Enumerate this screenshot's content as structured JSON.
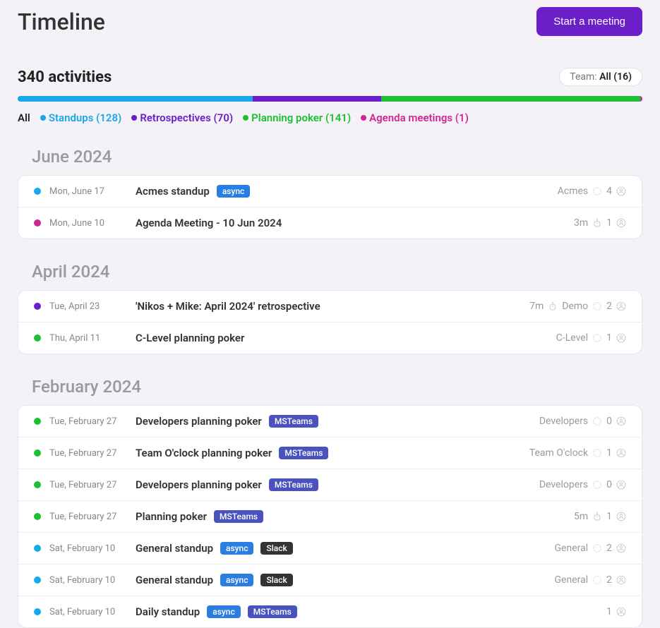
{
  "header": {
    "title": "Timeline",
    "start_button": "Start a meeting"
  },
  "summary": {
    "count_text": "340 activities",
    "team_label": "Team: ",
    "team_value": "All (16)"
  },
  "segments": {
    "standups_pct": 37.6,
    "retros_pct": 20.6,
    "poker_pct": 41.5,
    "agenda_pct": 0.3
  },
  "filters": {
    "all": "All",
    "standups": "Standups (128)",
    "retros": "Retrospectives (70)",
    "poker": "Planning poker (141)",
    "agenda": "Agenda meetings (1)"
  },
  "badges": {
    "async": "async",
    "msteams": "MSTeams",
    "slack": "Slack"
  },
  "groups": [
    {
      "month": "June 2024",
      "items": [
        {
          "type": "standup",
          "date": "Mon, June 17",
          "title": "Acmes standup",
          "badges": [
            "async"
          ],
          "duration": "",
          "team": "Acmes",
          "people": "4"
        },
        {
          "type": "agenda",
          "date": "Mon, June 10",
          "title": "Agenda Meeting - 10 Jun 2024",
          "badges": [],
          "duration": "3m",
          "team": "",
          "people": "1"
        }
      ]
    },
    {
      "month": "April 2024",
      "items": [
        {
          "type": "retro",
          "date": "Tue, April 23",
          "title": "'Nikos + Mike: April 2024' retrospective",
          "badges": [],
          "duration": "7m",
          "team": "Demo",
          "people": "2"
        },
        {
          "type": "poker",
          "date": "Thu, April 11",
          "title": "C-Level planning poker",
          "badges": [],
          "duration": "",
          "team": "C-Level",
          "people": "1"
        }
      ]
    },
    {
      "month": "February 2024",
      "items": [
        {
          "type": "poker",
          "date": "Tue, February 27",
          "title": "Developers planning poker",
          "badges": [
            "msteams"
          ],
          "duration": "",
          "team": "Developers",
          "people": "0"
        },
        {
          "type": "poker",
          "date": "Tue, February 27",
          "title": "Team O'clock planning poker",
          "badges": [
            "msteams"
          ],
          "duration": "",
          "team": "Team O'clock",
          "people": "1"
        },
        {
          "type": "poker",
          "date": "Tue, February 27",
          "title": "Developers planning poker",
          "badges": [
            "msteams"
          ],
          "duration": "",
          "team": "Developers",
          "people": "0"
        },
        {
          "type": "poker",
          "date": "Tue, February 27",
          "title": "Planning poker",
          "badges": [
            "msteams"
          ],
          "duration": "5m",
          "team": "",
          "people": "1"
        },
        {
          "type": "standup",
          "date": "Sat, February 10",
          "title": "General standup",
          "badges": [
            "async",
            "slack"
          ],
          "duration": "",
          "team": "General",
          "people": "2"
        },
        {
          "type": "standup",
          "date": "Sat, February 10",
          "title": "General standup",
          "badges": [
            "async",
            "slack"
          ],
          "duration": "",
          "team": "General",
          "people": "2"
        },
        {
          "type": "standup",
          "date": "Sat, February 10",
          "title": "Daily standup",
          "badges": [
            "async",
            "msteams"
          ],
          "duration": "",
          "team": "",
          "people": "1"
        }
      ]
    }
  ]
}
